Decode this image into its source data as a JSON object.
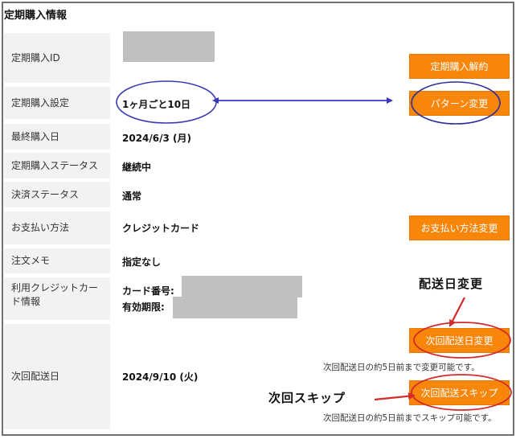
{
  "section": {
    "title": "定期購入情報"
  },
  "rows": [
    {
      "label": "定期購入ID",
      "value": ""
    },
    {
      "label": "定期購入設定",
      "value": "1ヶ月ごと10日"
    },
    {
      "label": "最終購入日",
      "value": "2024/6/3 (月)"
    },
    {
      "label": "定期購入ステータス",
      "value": "継続中"
    },
    {
      "label": "決済ステータス",
      "value": "通常"
    },
    {
      "label": "お支払い方法",
      "value": "クレジットカード"
    },
    {
      "label": "注文メモ",
      "value": "指定なし"
    },
    {
      "label": "利用クレジットカード情報",
      "card_number_label": "カード番号:",
      "expiry_label": "有効期限:"
    },
    {
      "label": "次回配送日",
      "value": "2024/9/10 (火)"
    }
  ],
  "buttons": {
    "cancel_subscription": "定期購入解約",
    "change_pattern": "パターン変更",
    "change_payment": "お支払い方法変更",
    "change_delivery_date": "次回配送日変更",
    "skip_delivery": "次回配送スキップ"
  },
  "notes": {
    "change_delivery_date": "次回配送日の約5日前まで変更可能です。",
    "skip_delivery": "次回配送日の約5日前までスキップ可能です。"
  },
  "annotations": {
    "delivery_change": "配送日変更",
    "skip": "次回スキップ"
  },
  "colors": {
    "button": "#f7860a",
    "annotation_blue": "#3a3ab5",
    "annotation_red": "#d42a2a"
  }
}
